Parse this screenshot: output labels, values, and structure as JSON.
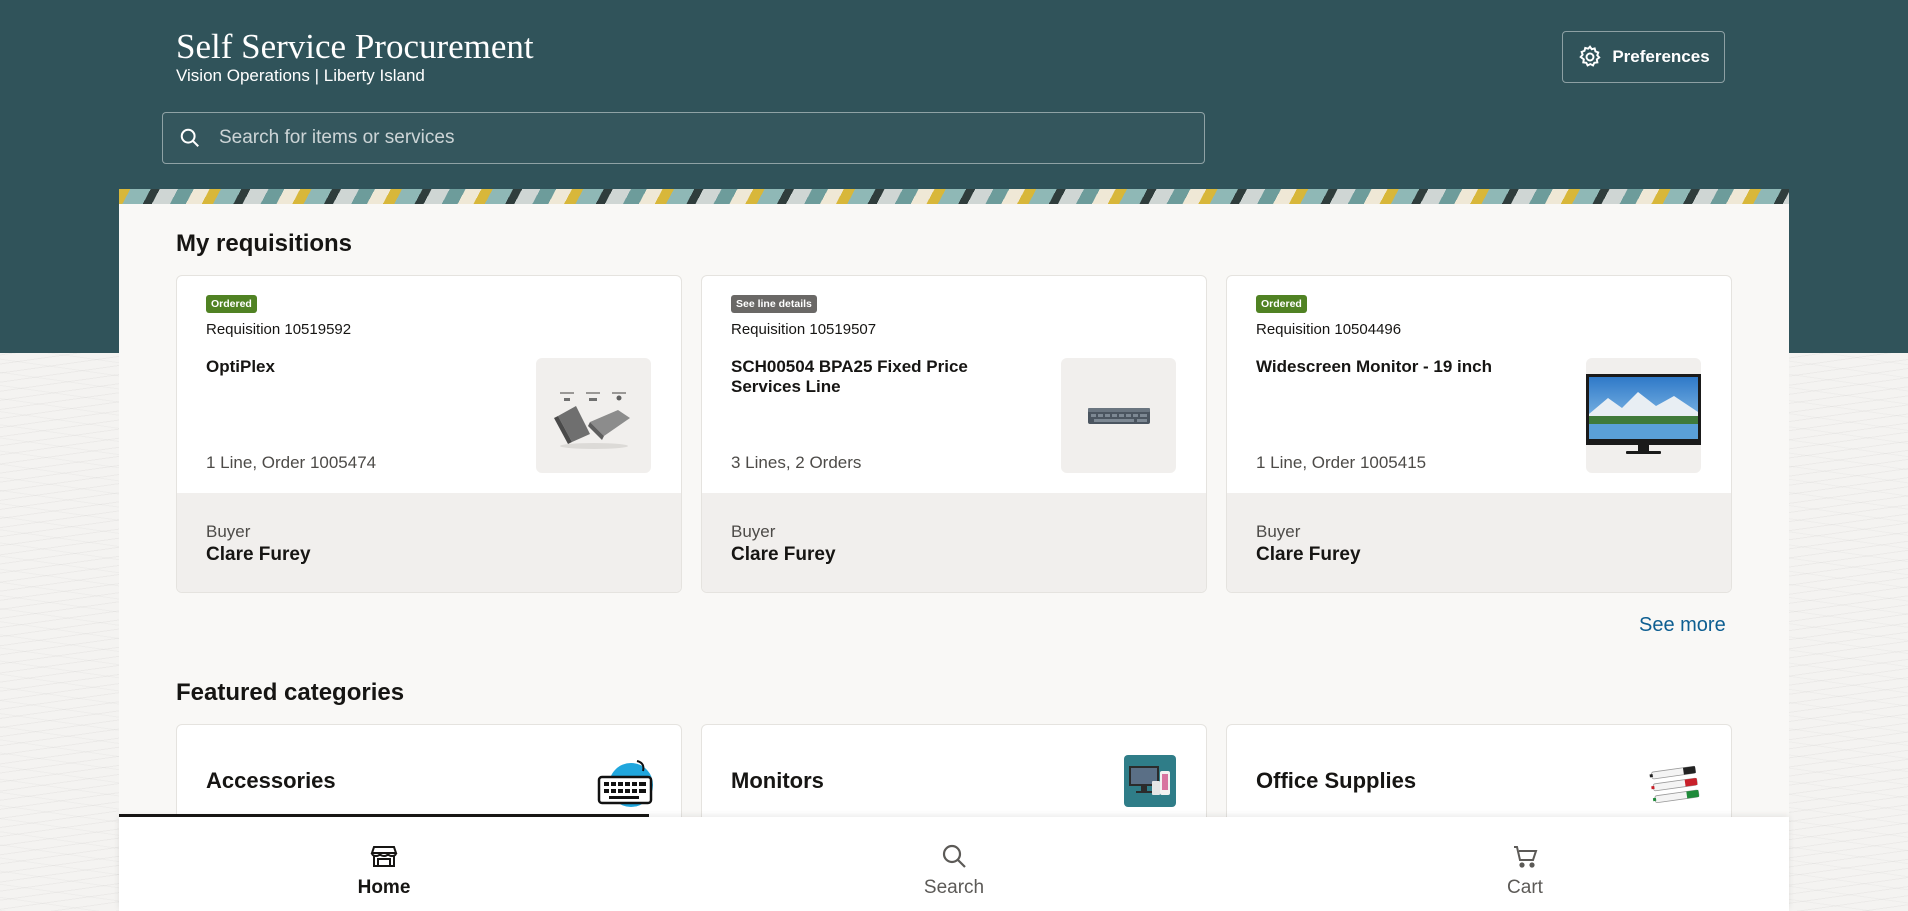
{
  "header": {
    "title": "Self Service Procurement",
    "subtitle": "Vision Operations | Liberty Island",
    "preferences_label": "Preferences",
    "search_placeholder": "Search for items or services"
  },
  "requisitions": {
    "title": "My requisitions",
    "cards": [
      {
        "status": "Ordered",
        "number": "Requisition 10519592",
        "item": "OptiPlex",
        "lines": "1 Line, Order 1005474",
        "buyer_label": "Buyer",
        "buyer": "Clare Furey",
        "thumb_icon": "computer-parts-icon"
      },
      {
        "status": "See line details",
        "number": "Requisition 10519507",
        "item": "SCH00504 BPA25 Fixed Price Services Line",
        "lines": "3 Lines, 2 Orders",
        "buyer_label": "Buyer",
        "buyer": "Clare Furey",
        "thumb_icon": "keyboard-icon"
      },
      {
        "status": "Ordered",
        "number": "Requisition 10504496",
        "item": "Widescreen Monitor - 19 inch",
        "lines": "1 Line, Order 1005415",
        "buyer_label": "Buyer",
        "buyer": "Clare Furey",
        "thumb_icon": "monitor-icon"
      }
    ],
    "see_more": "See more"
  },
  "categories": {
    "title": "Featured categories",
    "items": [
      {
        "label": "Accessories",
        "icon": "keyboard-icon"
      },
      {
        "label": "Monitors",
        "icon": "monitor-icon"
      },
      {
        "label": "Office Supplies",
        "icon": "markers-icon"
      }
    ]
  },
  "nav": {
    "home": "Home",
    "search": "Search",
    "cart": "Cart",
    "active": "Home"
  },
  "colors": {
    "header_bg": "#30535a",
    "ordered_badge": "#508223",
    "neutral_badge": "#6a6866",
    "link": "#0d5e91"
  }
}
